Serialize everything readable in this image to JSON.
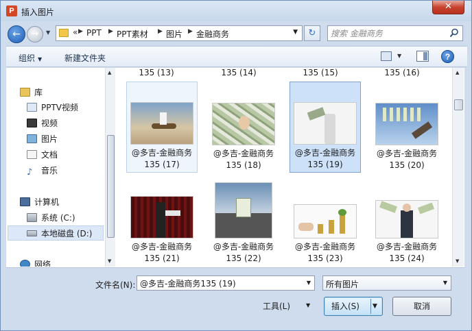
{
  "window": {
    "title": "插入图片",
    "app_icon_letter": "P",
    "close_label": "✕"
  },
  "nav": {
    "back_icon": "←",
    "forward_icon": "→",
    "history_icon": "▼",
    "breadcrumb_root": "«",
    "breadcrumbs": [
      "PPT",
      "PPT素材",
      "图片",
      "金融商务"
    ],
    "address_dropdown": "▼",
    "refresh_icon": "↻"
  },
  "search": {
    "placeholder": "搜索 金融商务"
  },
  "toolbar": {
    "organize_label": "组织",
    "organize_caret": "▼",
    "new_folder_label": "新建文件夹",
    "view_dropdown": "▼",
    "help_label": "?"
  },
  "sidebar": {
    "items": [
      {
        "label": "库",
        "icon": "library-icon"
      },
      {
        "label": "PPTV视频",
        "icon": "pptv-video-icon"
      },
      {
        "label": "视频",
        "icon": "video-icon"
      },
      {
        "label": "图片",
        "icon": "pictures-icon"
      },
      {
        "label": "文档",
        "icon": "documents-icon"
      },
      {
        "label": "音乐",
        "icon": "music-icon"
      },
      {
        "label": "计算机",
        "icon": "computer-icon"
      },
      {
        "label": "系统 (C:)",
        "icon": "drive-c-icon"
      },
      {
        "label": "本地磁盘 (D:)",
        "icon": "drive-d-icon"
      },
      {
        "label": "网络",
        "icon": "network-icon"
      }
    ],
    "selected_index": 8
  },
  "files": {
    "top_row_labels": [
      "135 (13)",
      "135 (14)",
      "135 (15)",
      "135 (16)"
    ],
    "caption_prefix": "@多吉-金融商务",
    "items": [
      {
        "line1": "@多吉-金融商务",
        "line2": "135 (17)",
        "state": "hover"
      },
      {
        "line1": "@多吉-金融商务",
        "line2": "135 (18)",
        "state": "normal"
      },
      {
        "line1": "@多吉-金融商务",
        "line2": "135 (19)",
        "state": "selected"
      },
      {
        "line1": "@多吉-金融商务",
        "line2": "135 (20)",
        "state": "normal"
      },
      {
        "line1": "@多吉-金融商务",
        "line2": "135 (21)",
        "state": "normal"
      },
      {
        "line1": "@多吉-金融商务",
        "line2": "135 (22)",
        "state": "normal"
      },
      {
        "line1": "@多吉-金融商务",
        "line2": "135 (23)",
        "state": "normal"
      },
      {
        "line1": "@多吉-金融商务",
        "line2": "135 (24)",
        "state": "normal"
      }
    ]
  },
  "bottom": {
    "filename_label": "文件名(N):",
    "filename_value": "@多吉-金融商务135 (19)",
    "filetype_value": "所有图片",
    "tools_label": "工具(L)",
    "tools_caret": "▼",
    "insert_label": "插入(S)",
    "insert_caret": "▼",
    "cancel_label": "取消"
  },
  "colors": {
    "selection": "#cde1f8",
    "window_frame": "#cfdced",
    "accent_blue": "#1f5eb8"
  }
}
